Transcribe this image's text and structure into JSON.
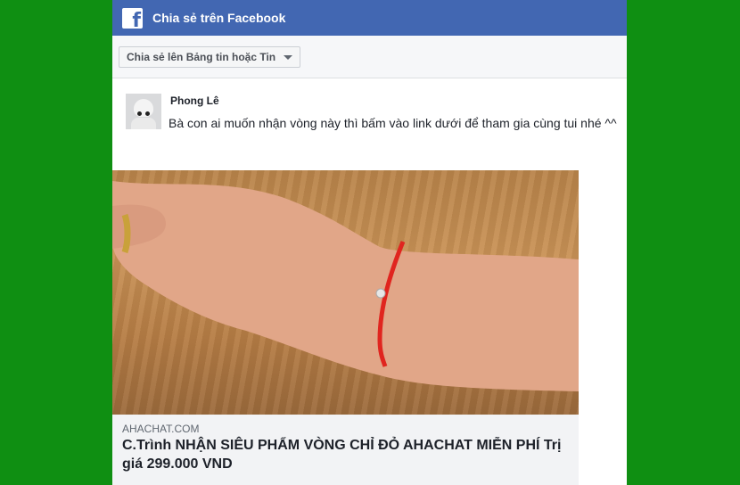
{
  "header": {
    "title": "Chia sẻ trên Facebook",
    "icon": "facebook-logo-icon",
    "icon_glyph": "f"
  },
  "toolbar": {
    "destination_label": "Chia sẻ lên Bảng tin hoặc Tin"
  },
  "post": {
    "author": "Phong Lê",
    "message": "Bà con ai muốn nhận vòng này thì bấm vào link dưới để tham gia cùng tui nhé ^^"
  },
  "attachment": {
    "domain": "AHACHAT.COM",
    "title": "C.Trình NHẬN SIÊU PHẨM VÒNG CHỈ ĐỎ AHACHAT MIỄN PHÍ Trị giá 299.000 VND"
  },
  "colors": {
    "background": "#0f8f12",
    "header": "#4267b2",
    "bracelet": "#e0251f"
  }
}
